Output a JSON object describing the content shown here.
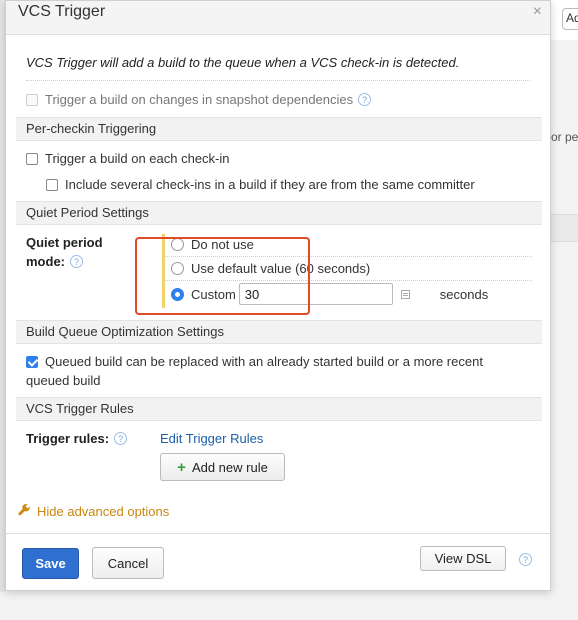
{
  "dialog": {
    "title": "VCS Trigger",
    "close_icon": "×",
    "intro": "VCS Trigger will add a build to the queue when a VCS check-in is detected.",
    "snapshot_label": "Trigger a build on changes in snapshot dependencies",
    "help_glyph": "?"
  },
  "per_checkin": {
    "header": "Per-checkin Triggering",
    "each_checkin_label": "Trigger a build on each check-in",
    "several_label": "Include several check-ins in a build if they are from the same committer"
  },
  "quiet_period": {
    "header": "Quiet Period Settings",
    "mode_label_line1": "Quiet period",
    "mode_label_line2": "mode:",
    "options": [
      {
        "label": "Do not use",
        "selected": false
      },
      {
        "label": "Use default value (60 seconds)",
        "selected": false
      },
      {
        "label": "Custom",
        "selected": true
      }
    ],
    "custom_value": "30",
    "unit": "seconds"
  },
  "queue_opt": {
    "header": "Build Queue Optimization Settings",
    "replace_label_line1": "Queued build can be replaced with an already started build or a more recent",
    "replace_label_line2": "queued build",
    "replace_checked": true
  },
  "rules": {
    "header": "VCS Trigger Rules",
    "label": "Trigger rules:",
    "edit_link": "Edit Trigger Rules",
    "add_button": "Add new rule",
    "add_icon": "+"
  },
  "advanced": {
    "label": "Hide advanced options",
    "icon": "wrench-icon"
  },
  "footer": {
    "save": "Save",
    "cancel": "Cancel",
    "view_dsl": "View DSL"
  },
  "background": {
    "chip_text": "Ad",
    "side_text": "or pe"
  },
  "colors": {
    "primary": "#2f6fcf",
    "link": "#1a5fa8",
    "advanced": "#c9860f",
    "highlight_box": "#e24a24"
  }
}
